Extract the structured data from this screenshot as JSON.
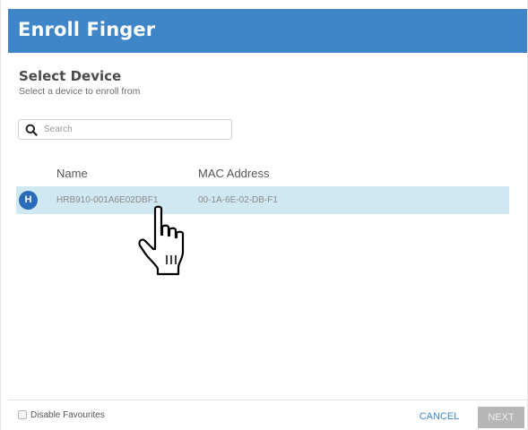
{
  "dialog": {
    "title": "Enroll Finger"
  },
  "section": {
    "title": "Select Device",
    "subtitle": "Select a device to enroll from"
  },
  "search": {
    "placeholder": "Search",
    "value": ""
  },
  "table": {
    "columns": [
      "Name",
      "MAC Address"
    ],
    "rows": [
      {
        "avatar_letter": "H",
        "name": "HRB910-001A6E02DBF1",
        "mac": "00-1A-6E-02-DB-F1"
      }
    ]
  },
  "footer": {
    "disable_favourites_label": "Disable Favourites",
    "cancel_label": "CANCEL",
    "next_label": "NEXT"
  },
  "colors": {
    "header_bg": "#3e86c8",
    "row_selected_bg": "#cfe8f2",
    "avatar_bg": "#2b6cb8",
    "next_disabled_bg": "#b6b6b6"
  },
  "icons": {
    "search": "magnifier",
    "cursor": "hand-pointer"
  }
}
